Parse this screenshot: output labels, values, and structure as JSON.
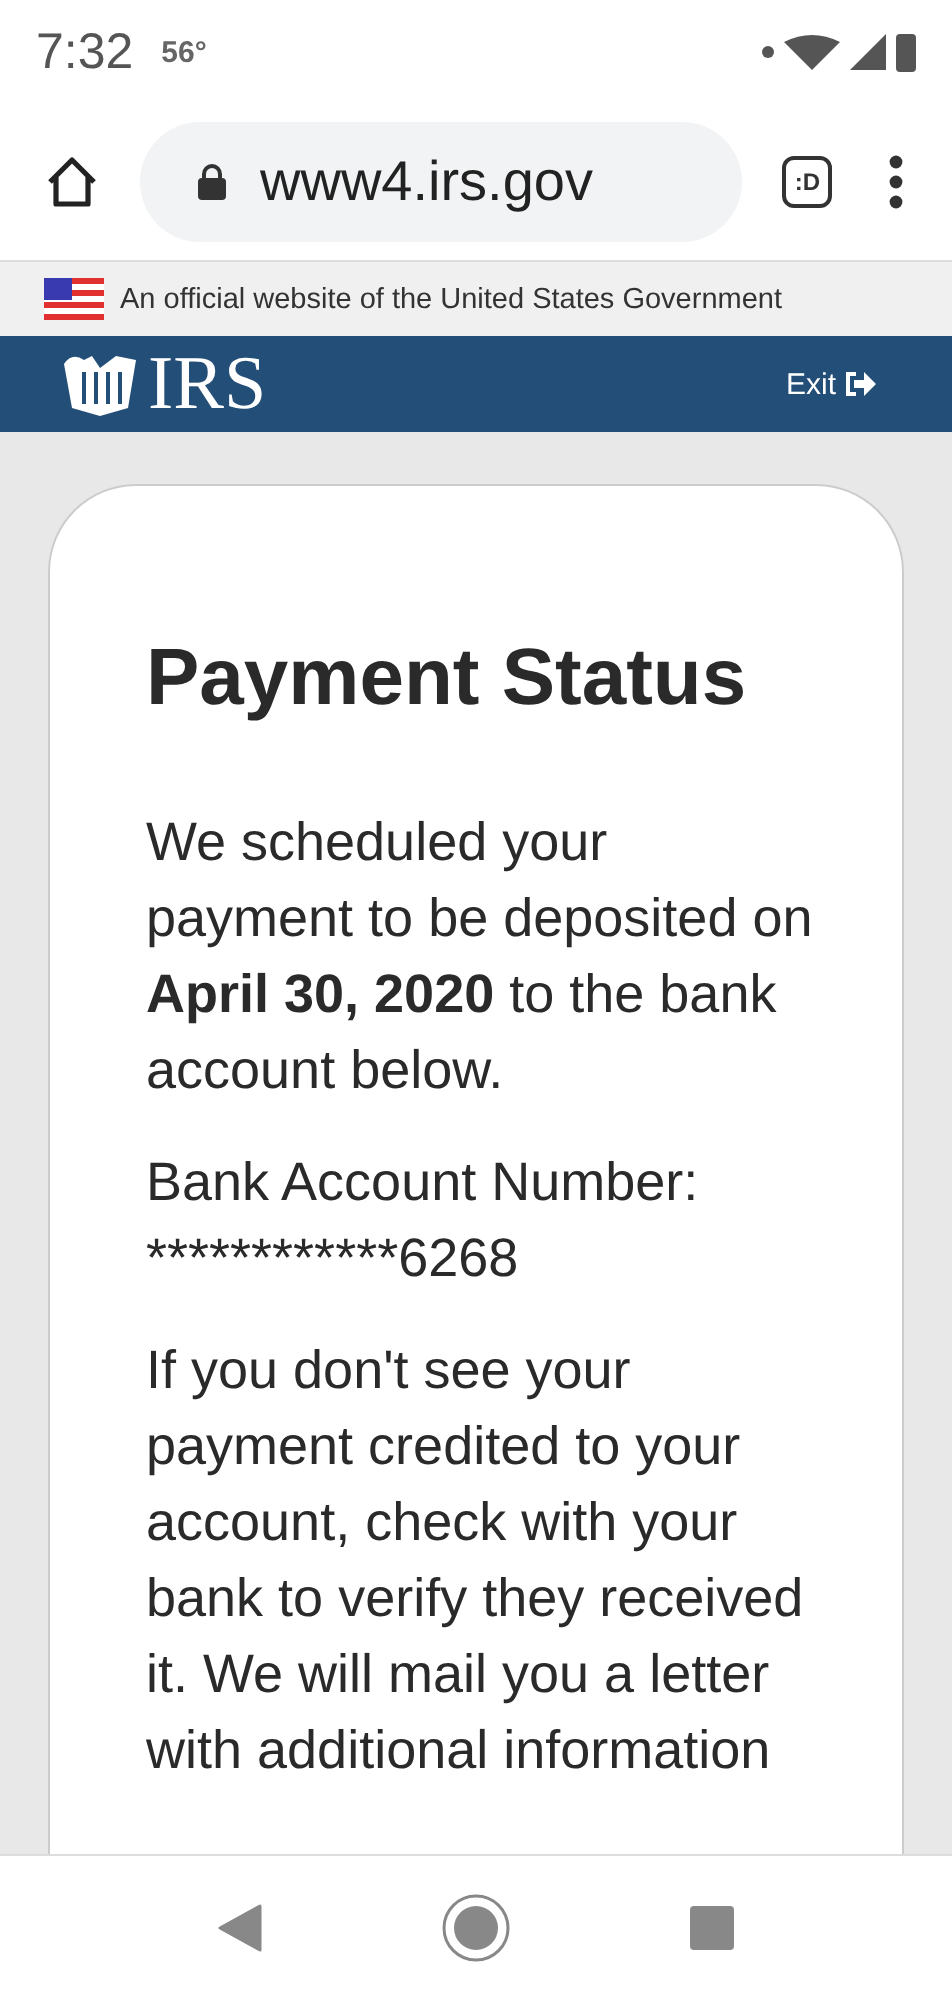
{
  "status_bar": {
    "time": "7:32",
    "temperature": "56°"
  },
  "browser": {
    "url": "www4.irs.gov",
    "tab_count": ":D"
  },
  "gov_banner": {
    "text": "An official website of the United States Government"
  },
  "header": {
    "logo": "IRS",
    "exit": "Exit"
  },
  "card": {
    "title": "Payment Status",
    "intro": "We scheduled your payment to be deposited on **April 30, 2020** to the bank account below.",
    "account": "Bank Account Number: ************6268",
    "notice": "If you don't see your payment credited to your account, check with your bank to verify they received it. We will mail you a letter with additional information"
  }
}
